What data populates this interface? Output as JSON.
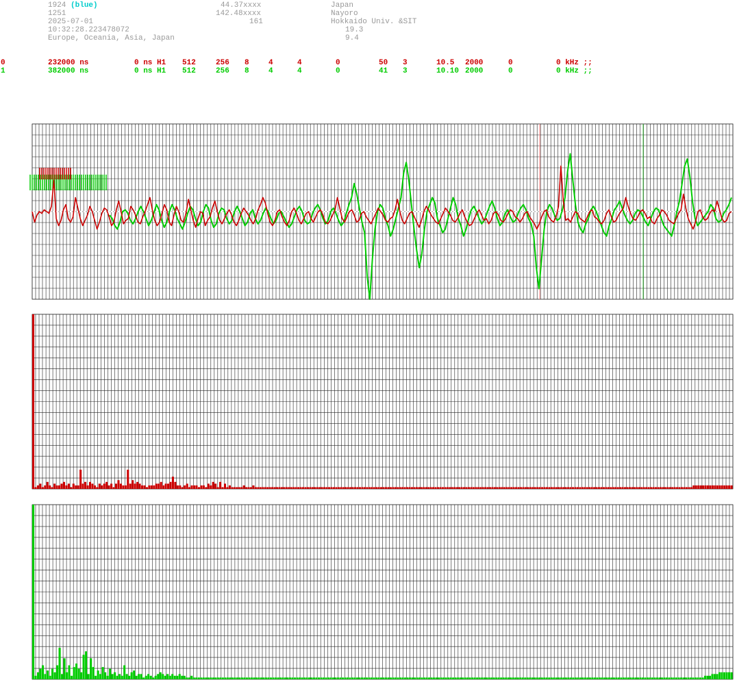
{
  "header": {
    "station_id": "1924",
    "color_tag": "(blue)",
    "altitude": "1251",
    "date": "2025-07-01",
    "time": "10:32:28.223478072",
    "region": "Europe, Oceania, Asia, Japan",
    "latitude": "44.37xxxx",
    "longitude": "142.48xxxx",
    "value_161": "161",
    "country": "Japan",
    "city": "Nayoro",
    "org": "Hokkaido Univ. &SIT",
    "value_193": "19.3",
    "value_94": "9.4"
  },
  "channels": [
    {
      "cols": [
        "0",
        "232000 ns",
        "0 ns H1",
        "512",
        "256",
        "8",
        "4",
        "4",
        "0",
        "50",
        "3",
        "10.5",
        "2000",
        "0",
        "0 kHz ;;"
      ],
      "color": "#cc0000"
    },
    {
      "cols": [
        "1",
        "382000 ns",
        "0 ns H1",
        "512",
        "256",
        "8",
        "4",
        "4",
        "0",
        "41",
        "3",
        "10.10",
        "2000",
        "0",
        "0 kHz ;;"
      ],
      "color": "#00cc00"
    }
  ],
  "chart_data": [
    {
      "type": "line",
      "series": [
        {
          "values": [
            2,
            -4,
            0,
            2,
            1,
            3,
            2,
            1,
            5,
            20,
            -2,
            -6,
            -3,
            3,
            6,
            -2,
            -4,
            -1,
            10,
            4,
            -2,
            -6,
            -3,
            0,
            5,
            2,
            -3,
            -8,
            -4,
            1,
            4,
            3,
            -1,
            -6,
            -4,
            3,
            8,
            2,
            -5,
            -3,
            -2,
            5,
            3,
            0,
            -4,
            -5,
            -1,
            2,
            6,
            10,
            3,
            -3,
            -6,
            -4,
            1,
            6,
            3,
            -4,
            -6,
            0,
            5,
            2,
            -3,
            -4,
            1,
            9,
            3,
            -3,
            -7,
            -2,
            2,
            1,
            -6,
            -3,
            -1,
            4,
            8,
            2,
            -3,
            -5,
            -2,
            1,
            3,
            0,
            -4,
            -6,
            -3,
            1,
            4,
            2,
            0,
            -3,
            -5,
            -2,
            3,
            6,
            10,
            7,
            1,
            -4,
            -6,
            -3,
            2,
            3,
            -1,
            -4,
            -6,
            -3,
            2,
            4,
            1,
            -3,
            -5,
            -2,
            1,
            2,
            -2,
            -4,
            -1,
            2,
            3,
            0,
            -4,
            -5,
            -3,
            0,
            3,
            10,
            4,
            -2,
            -4,
            -1,
            2,
            3,
            0,
            -4,
            -3,
            1,
            2,
            -1,
            -3,
            -5,
            -2,
            1,
            4,
            2,
            0,
            -3,
            -4,
            -2,
            -1,
            3,
            9,
            2,
            -3,
            -5,
            -2,
            1,
            2,
            -1,
            -4,
            -7,
            -3,
            2,
            5,
            3,
            0,
            -2,
            -4,
            -5,
            -2,
            1,
            4,
            2,
            0,
            -3,
            -4,
            -2,
            1,
            3,
            -1,
            -4,
            -6,
            -5,
            -2,
            1,
            3,
            0,
            -3,
            -2,
            -5,
            -3,
            1,
            2,
            0,
            -3,
            -4,
            -2,
            1,
            3,
            2,
            -1,
            -2,
            -4,
            -2,
            1,
            2,
            -1,
            -3,
            -5,
            -8,
            -5,
            -1,
            2,
            3,
            -1,
            -3,
            -4,
            -1,
            5,
            28,
            8,
            -3,
            -2,
            -4,
            -1,
            2,
            1,
            -2,
            -3,
            -4,
            -1,
            2,
            3,
            -1,
            -2,
            -4,
            -5,
            -3,
            1,
            3,
            -1,
            -4,
            -3,
            0,
            2,
            4,
            10,
            5,
            1,
            -2,
            -3,
            -1,
            2,
            3,
            1,
            -2,
            -1,
            -4,
            -5,
            -2,
            0,
            3,
            2,
            0,
            -3,
            -4,
            -5,
            -2,
            1,
            3,
            12,
            4,
            -2,
            -5,
            -8,
            -4,
            2,
            3,
            -1,
            -3,
            -2,
            1,
            3,
            2,
            8,
            3,
            -2,
            -4,
            -3,
            1,
            2
          ],
          "min": -48,
          "max": 52
        },
        {
          "values": [
            0,
            -2,
            -6,
            -8,
            -4,
            2,
            3,
            1,
            -3,
            -5,
            -2,
            2,
            5,
            2,
            -2,
            -6,
            -3,
            1,
            6,
            3,
            -3,
            -7,
            -4,
            2,
            6,
            3,
            -2,
            -5,
            -8,
            -4,
            1,
            5,
            3,
            -2,
            -6,
            -4,
            2,
            6,
            4,
            -3,
            -7,
            -5,
            1,
            4,
            3,
            -2,
            -5,
            -3,
            2,
            5,
            2,
            -2,
            -6,
            -4,
            1,
            3,
            -2,
            -5,
            -3,
            1,
            4,
            2,
            -2,
            -5,
            -3,
            1,
            2,
            -1,
            -4,
            -7,
            -5,
            -1,
            3,
            5,
            2,
            -3,
            -5,
            -4,
            1,
            4,
            6,
            3,
            -2,
            -5,
            -3,
            2,
            4,
            1,
            -3,
            -6,
            -4,
            1,
            6,
            10,
            18,
            12,
            4,
            -4,
            -10,
            -35,
            -48,
            -25,
            -8,
            2,
            6,
            4,
            -2,
            -6,
            -12,
            -8,
            -2,
            4,
            10,
            24,
            30,
            20,
            6,
            -8,
            -20,
            -30,
            -22,
            -8,
            2,
            6,
            10,
            7,
            -2,
            -6,
            -10,
            -8,
            -2,
            4,
            10,
            6,
            -2,
            -6,
            -12,
            -8,
            -2,
            3,
            5,
            2,
            -2,
            -5,
            -3,
            1,
            5,
            8,
            4,
            -2,
            -6,
            -4,
            1,
            3,
            -1,
            -4,
            -3,
            1,
            4,
            6,
            3,
            -2,
            -5,
            -12,
            -30,
            -42,
            -25,
            -8,
            2,
            6,
            4,
            0,
            -3,
            -2,
            3,
            10,
            25,
            35,
            20,
            6,
            -4,
            -8,
            -10,
            -5,
            -2,
            3,
            5,
            2,
            -2,
            -6,
            -10,
            -12,
            -6,
            -2,
            3,
            5,
            8,
            4,
            0,
            -3,
            -5,
            -3,
            1,
            3,
            2,
            -1,
            -4,
            -6,
            -2,
            2,
            4,
            3,
            -2,
            -6,
            -8,
            -10,
            -12,
            -6,
            2,
            8,
            18,
            28,
            32,
            22,
            8,
            -2,
            -6,
            -4,
            -2,
            0,
            2,
            6,
            4,
            -2,
            -4,
            -3,
            1,
            3,
            6,
            10
          ],
          "min": -48,
          "max": 52
        }
      ],
      "ylim": [
        -48,
        52
      ]
    },
    {
      "type": "bar",
      "series": [
        {
          "values": [
            100,
            1,
            2,
            3,
            1,
            2,
            4,
            2,
            1,
            3,
            2,
            2,
            3,
            4,
            2,
            3,
            1,
            3,
            2,
            2,
            11,
            3,
            4,
            2,
            4,
            3,
            2,
            1,
            3,
            2,
            3,
            4,
            2,
            3,
            1,
            3,
            5,
            3,
            2,
            2,
            11,
            3,
            5,
            3,
            4,
            3,
            2,
            2,
            1,
            2,
            2,
            2,
            3,
            3,
            4,
            2,
            3,
            3,
            4,
            7,
            4,
            2,
            2,
            1,
            2,
            3,
            1,
            2,
            2,
            2,
            1,
            2,
            2,
            1,
            3,
            2,
            4,
            3,
            1,
            4,
            1,
            3,
            1,
            2,
            1,
            1,
            1,
            1,
            1,
            2,
            1,
            1,
            1,
            2,
            1,
            1,
            1,
            1,
            1,
            1,
            1,
            1,
            1,
            1,
            1,
            1,
            1,
            1,
            1,
            1,
            1,
            1,
            1,
            1,
            1,
            1,
            1,
            1,
            1,
            1,
            1,
            1,
            1,
            1,
            1,
            1,
            1,
            1,
            1,
            1,
            1,
            1,
            1,
            1,
            1,
            1,
            1,
            1,
            1,
            1,
            1,
            1,
            1,
            1,
            1,
            1,
            1,
            1,
            1,
            1,
            1,
            1,
            1,
            1,
            1,
            1,
            1,
            1,
            1,
            1,
            1,
            1,
            1,
            1,
            1,
            1,
            1,
            1,
            1,
            1,
            1,
            1,
            1,
            1,
            1,
            1,
            1,
            1,
            1,
            1,
            1,
            1,
            1,
            1,
            1,
            1,
            1,
            1,
            1,
            1,
            1,
            1,
            1,
            1,
            1,
            1,
            1,
            1,
            1,
            1,
            1,
            1,
            1,
            1,
            1,
            1,
            1,
            1,
            1,
            1,
            1,
            1,
            1,
            1,
            1,
            1,
            1,
            1,
            1,
            1,
            1,
            1,
            1,
            1,
            1,
            1,
            1,
            1,
            1,
            1,
            1,
            1,
            1,
            1,
            1,
            1,
            1,
            1,
            1,
            1,
            1,
            1,
            1,
            1,
            1,
            1,
            1,
            1,
            1,
            1,
            1,
            1,
            1,
            1,
            1,
            1,
            1,
            1,
            1,
            1,
            1,
            1,
            1,
            1,
            1,
            1,
            1,
            1,
            1,
            1,
            1,
            1,
            1,
            1,
            1,
            1,
            1,
            1,
            1,
            2,
            2,
            2,
            2,
            2,
            2,
            2,
            2,
            2,
            2,
            2,
            2,
            2,
            2,
            2,
            2,
            2
          ]
        }
      ],
      "ylim": [
        0,
        100
      ]
    },
    {
      "type": "bar",
      "series": [
        {
          "values": [
            100,
            2,
            4,
            6,
            8,
            3,
            5,
            2,
            6,
            4,
            8,
            18,
            3,
            12,
            4,
            8,
            2,
            7,
            9,
            6,
            4,
            14,
            16,
            3,
            12,
            7,
            2,
            5,
            3,
            7,
            4,
            2,
            6,
            3,
            4,
            2,
            3,
            2,
            8,
            3,
            2,
            4,
            5,
            2,
            3,
            3,
            1,
            2,
            3,
            2,
            1,
            2,
            3,
            4,
            3,
            2,
            3,
            2,
            3,
            2,
            2,
            3,
            2,
            2,
            1,
            1,
            2,
            1,
            1,
            1,
            1,
            1,
            1,
            1,
            1,
            1,
            1,
            1,
            1,
            1,
            1,
            1,
            1,
            1,
            1,
            1,
            1,
            1,
            1,
            1,
            1,
            1,
            1,
            1,
            1,
            1,
            1,
            1,
            1,
            1,
            1,
            1,
            1,
            1,
            1,
            1,
            1,
            1,
            1,
            1,
            1,
            1,
            1,
            1,
            1,
            1,
            1,
            1,
            1,
            1,
            1,
            1,
            1,
            1,
            1,
            1,
            1,
            1,
            1,
            1,
            1,
            1,
            1,
            1,
            1,
            1,
            1,
            1,
            1,
            1,
            1,
            1,
            1,
            1,
            1,
            1,
            1,
            1,
            1,
            1,
            1,
            1,
            1,
            1,
            1,
            1,
            1,
            1,
            1,
            1,
            1,
            1,
            1,
            1,
            1,
            1,
            1,
            1,
            1,
            1,
            1,
            1,
            1,
            1,
            1,
            1,
            1,
            1,
            1,
            1,
            1,
            1,
            1,
            1,
            1,
            1,
            1,
            1,
            1,
            1,
            1,
            1,
            1,
            1,
            1,
            1,
            1,
            1,
            1,
            1,
            1,
            1,
            1,
            1,
            1,
            1,
            1,
            1,
            1,
            1,
            1,
            1,
            1,
            1,
            1,
            1,
            1,
            1,
            1,
            1,
            1,
            1,
            1,
            1,
            1,
            1,
            1,
            1,
            1,
            1,
            1,
            1,
            1,
            1,
            1,
            1,
            1,
            1,
            1,
            1,
            1,
            1,
            1,
            1,
            1,
            1,
            1,
            1,
            1,
            1,
            1,
            1,
            1,
            1,
            1,
            1,
            1,
            1,
            1,
            1,
            1,
            1,
            1,
            1,
            1,
            1,
            1,
            1,
            1,
            1,
            1,
            1,
            1,
            1,
            1,
            1,
            1,
            1,
            1,
            1,
            2,
            2,
            2,
            3,
            3,
            3,
            4,
            4,
            4,
            4,
            4,
            4
          ]
        }
      ],
      "ylim": [
        0,
        100
      ]
    }
  ]
}
